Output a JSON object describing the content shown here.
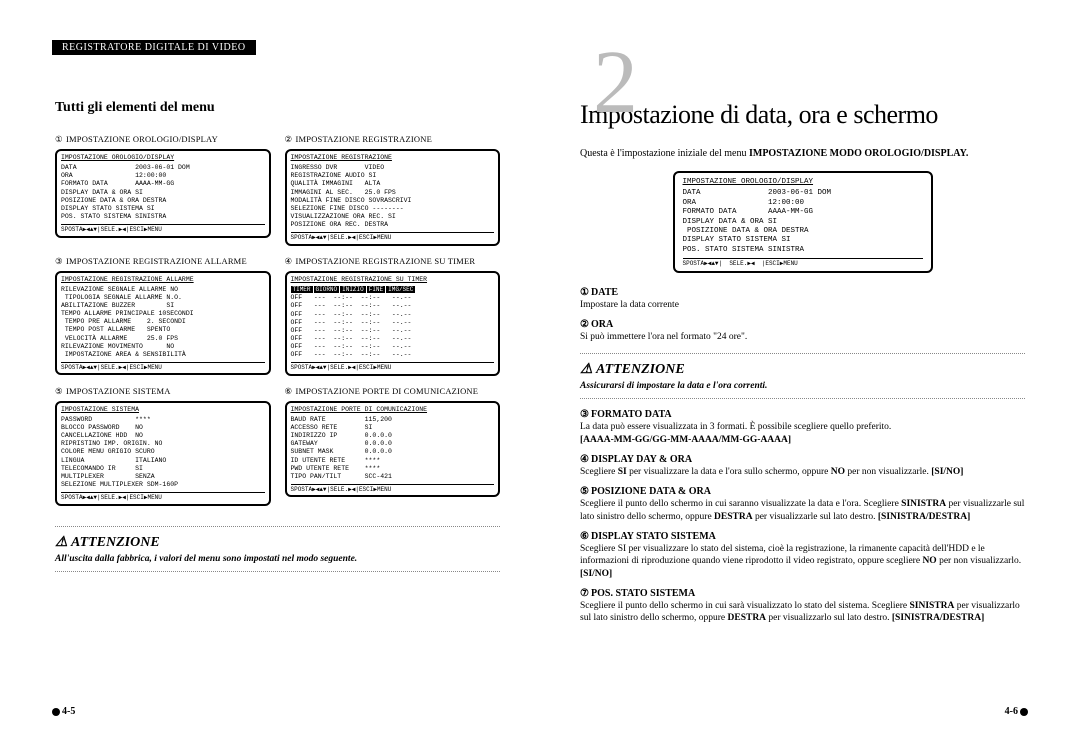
{
  "header": "REGISTRATORE DIGITALE DI VIDEO",
  "chapter_number": "2",
  "page_left": "4-5",
  "page_right": "4-6",
  "left": {
    "title": "Tutti gli elementi del menu",
    "menus": [
      {
        "num": "①",
        "label": "IMPOSTAZIONE  OROLOGIO/DISPLAY",
        "osd_title": "IMPOSTAZIONE OROLOGIO/DISPLAY",
        "osd_body": "DATA               2003-06-01 DOM\nORA                12:00:00\nFORMATO DATA       AAAA-MM-GG\nDISPLAY DATA & ORA SI\nPOSIZIONE DATA & ORA DESTRA\nDISPLAY STATO SISTEMA SI\nPOS. STATO SISTEMA SINISTRA",
        "osd_footer": "SPOSTA▶◀▲▼|SELE.▶◀|ESCI▶MENU"
      },
      {
        "num": "②",
        "label": "IMPOSTAZIONE REGISTRAZIONE",
        "osd_title": "IMPOSTAZIONE REGISTRAZIONE",
        "osd_body": "INGRESSO DVR       VIDEO\nREGISTRAZIONE AUDIO SI\nQUALITÀ IMMAGINI   ALTA\nIMMAGINI AL SEC.   25.0 FPS\nMODALITÀ FINE DISCO SOVRASCRIVI\nSELEZIONE FINE DISCO --------\nVISUALIZZAZIONE ORA REC. SI\nPOSIZIONE ORA REC. DESTRA",
        "osd_footer": "SPOSTA▶◀▲▼|SELE.▶◀|ESCI▶MENU"
      },
      {
        "num": "③",
        "label": "IMPOSTAZIONE REGISTRAZIONE ALLARME",
        "osd_title": "IMPOSTAZIONE REGISTRAZIONE ALLARME",
        "osd_body": "RILEVAZIONE SEGNALE ALLARME NO\n TIPOLOGIA SEGNALE ALLARME N.O.\nABILITAZIONE BUZZER        SI\nTEMPO ALLARME PRINCIPALE 10SECONDI\n TEMPO PRE ALLARME    2. SECONDI\n TEMPO POST ALLARME   SPENTO\n VELOCITÀ ALLARME     25.0 FPS\nRILEVAZIONE MOVIMENTO      NO\n IMPOSTAZIONE AREA & SENSIBILITÀ",
        "osd_footer": "SPOSTA▶◀▲▼|SELE.▶◀|ESCI▶MENU"
      },
      {
        "num": "④",
        "label": "IMPOSTAZIONE REGISTRAZIONE SU TIMER",
        "osd_title": "IMPOSTAZIONE REGISTRAZIONE SU TIMER",
        "osd_header_row": true,
        "osd_body": "OFF   ---  --:--  --:--   --.--\nOFF   ---  --:--  --:--   --.--\nOFF   ---  --:--  --:--   --.--\nOFF   ---  --:--  --:--   --.--\nOFF   ---  --:--  --:--   --.--\nOFF   ---  --:--  --:--   --.--\nOFF   ---  --:--  --:--   --.--\nOFF   ---  --:--  --:--   --.--",
        "osd_footer": "SPOSTA▶◀▲▼|SELE.▶◀|ESCI▶MENU"
      },
      {
        "num": "⑤",
        "label": "IMPOSTAZIONE SISTEMA",
        "osd_title": "IMPOSTAZIONE SISTEMA",
        "osd_body": "PASSWORD           ****\nBLOCCO PASSWORD    NO\nCANCELLAZIONE HDD  NO\nRIPRISTINO IMP. ORIGIN. NO\nCOLORE MENU GRIGIO SCURO\nLINGUA             ITALIANO\nTELECOMANDO IR     SI\nMULTIPLEXER        SENZA\nSELEZIONE MULTIPLEXER SDM-160P",
        "osd_footer": "SPOSTA▶◀▲▼|SELE.▶◀|ESCI▶MENU"
      },
      {
        "num": "⑥",
        "label": "IMPOSTAZIONE PORTE DI COMUNICAZIONE",
        "osd_title": "IMPOSTAZIONE PORTE DI COMUNICAZIONE",
        "osd_body": "BAUD RATE          115,200\nACCESSO RETE       SI\nINDIRIZZO IP       0.0.0.0\nGATEWAY            0.0.0.0\nSUBNET MASK        0.0.0.0\nID UTENTE RETE     ****\nPWD UTENTE RETE    ****\nTIPO PAN/TILT      SCC-421",
        "osd_footer": "SPOSTA▶◀▲▼|SELE.▶◀|ESCI▶MENU"
      }
    ],
    "attention_title": "ATTENZIONE",
    "attention_body": "All'uscita dalla fabbrica, i valori del menu sono impostati nel modo seguente."
  },
  "right": {
    "title": "Impostazione di data, ora e schermo",
    "intro_pre": "Questa è l'impostazione iniziale del menu ",
    "intro_bold": "IMPOSTAZIONE MODO OROLOGIO/DISPLAY.",
    "osd_title": "IMPOSTAZIONE OROLOGIO/DISPLAY",
    "osd_body": "DATA               2003-06-01 DOM\nORA                12:00:00\nFORMATO DATA       AAAA-MM-GG\nDISPLAY DATA & ORA SI\n POSIZIONE DATA & ORA DESTRA\nDISPLAY STATO SISTEMA SI\nPOS. STATO SISTEMA SINISTRA",
    "osd_footer": "SPOSTA▶◀▲▼|  SELE.▶◀  |ESCI▶MENU",
    "items": [
      {
        "num": "①",
        "heading": "DATE",
        "body": "Impostare la data corrente"
      },
      {
        "num": "②",
        "heading": "ORA",
        "body": "Si può immettere l'ora nel formato \"24 ore\"."
      }
    ],
    "attention_title": "ATTENZIONE",
    "attention_body": "Assicurarsi di impostare la data e l'ora correnti.",
    "items2": [
      {
        "num": "③",
        "heading": "FORMATO  DATA",
        "body_pre": "La data può essere visualizzata in 3 formati. È possibile scegliere quello preferito.",
        "body_bold": "[AAAA-MM-GG/GG-MM-AAAA/MM-GG-AAAA]"
      },
      {
        "num": "④",
        "heading": "DISPLAY DAY & ORA",
        "body_pre": "Scegliere ",
        "b1": "SI",
        "mid1": " per visualizzare la data e l'ora sullo schermo, oppure ",
        "b2": "NO",
        "mid2": " per non visualizzarle. ",
        "body_bold": "[SI/NO]"
      },
      {
        "num": "⑤",
        "heading": "POSIZIONE DATA & ORA",
        "body_pre": "Scegliere il punto dello schermo in cui saranno visualizzate la data e l'ora. Scegliere ",
        "b1": "SINISTRA",
        "mid1": " per visualizzarle sul lato sinistro dello schermo, oppure ",
        "b2": "DESTRA",
        "mid2": " per visualizzarle sul lato destro. ",
        "body_bold": "[SINISTRA/DESTRA]"
      },
      {
        "num": "⑥",
        "heading": "DISPLAY STATO SISTEMA",
        "body_pre": "Scegliere SI per visualizzare lo stato del sistema, cioè la registrazione, la rimanente capacità dell'HDD e le informazioni di riproduzione quando viene riprodotto il video registrato, oppure scegliere ",
        "b1": "NO",
        "mid1": " per non visualizzarlo.  ",
        "body_bold": "[SI/NO]"
      },
      {
        "num": "⑦",
        "heading": "POS. STATO SISTEMA",
        "body_pre": "Scegliere il punto dello schermo in cui sarà visualizzato lo stato del sistema. Scegliere ",
        "b1": "SINISTRA",
        "mid1": " per visualizzarlo sul lato sinistro dello schermo, oppure ",
        "b2": "DESTRA",
        "mid2": " per visualizzarlo sul lato destro. ",
        "body_bold": "[SINISTRA/DESTRA]"
      }
    ]
  },
  "timer_cols": [
    "TIMER",
    "GIORNO",
    "INIZIO",
    "FINE",
    "IMG/SEC"
  ]
}
